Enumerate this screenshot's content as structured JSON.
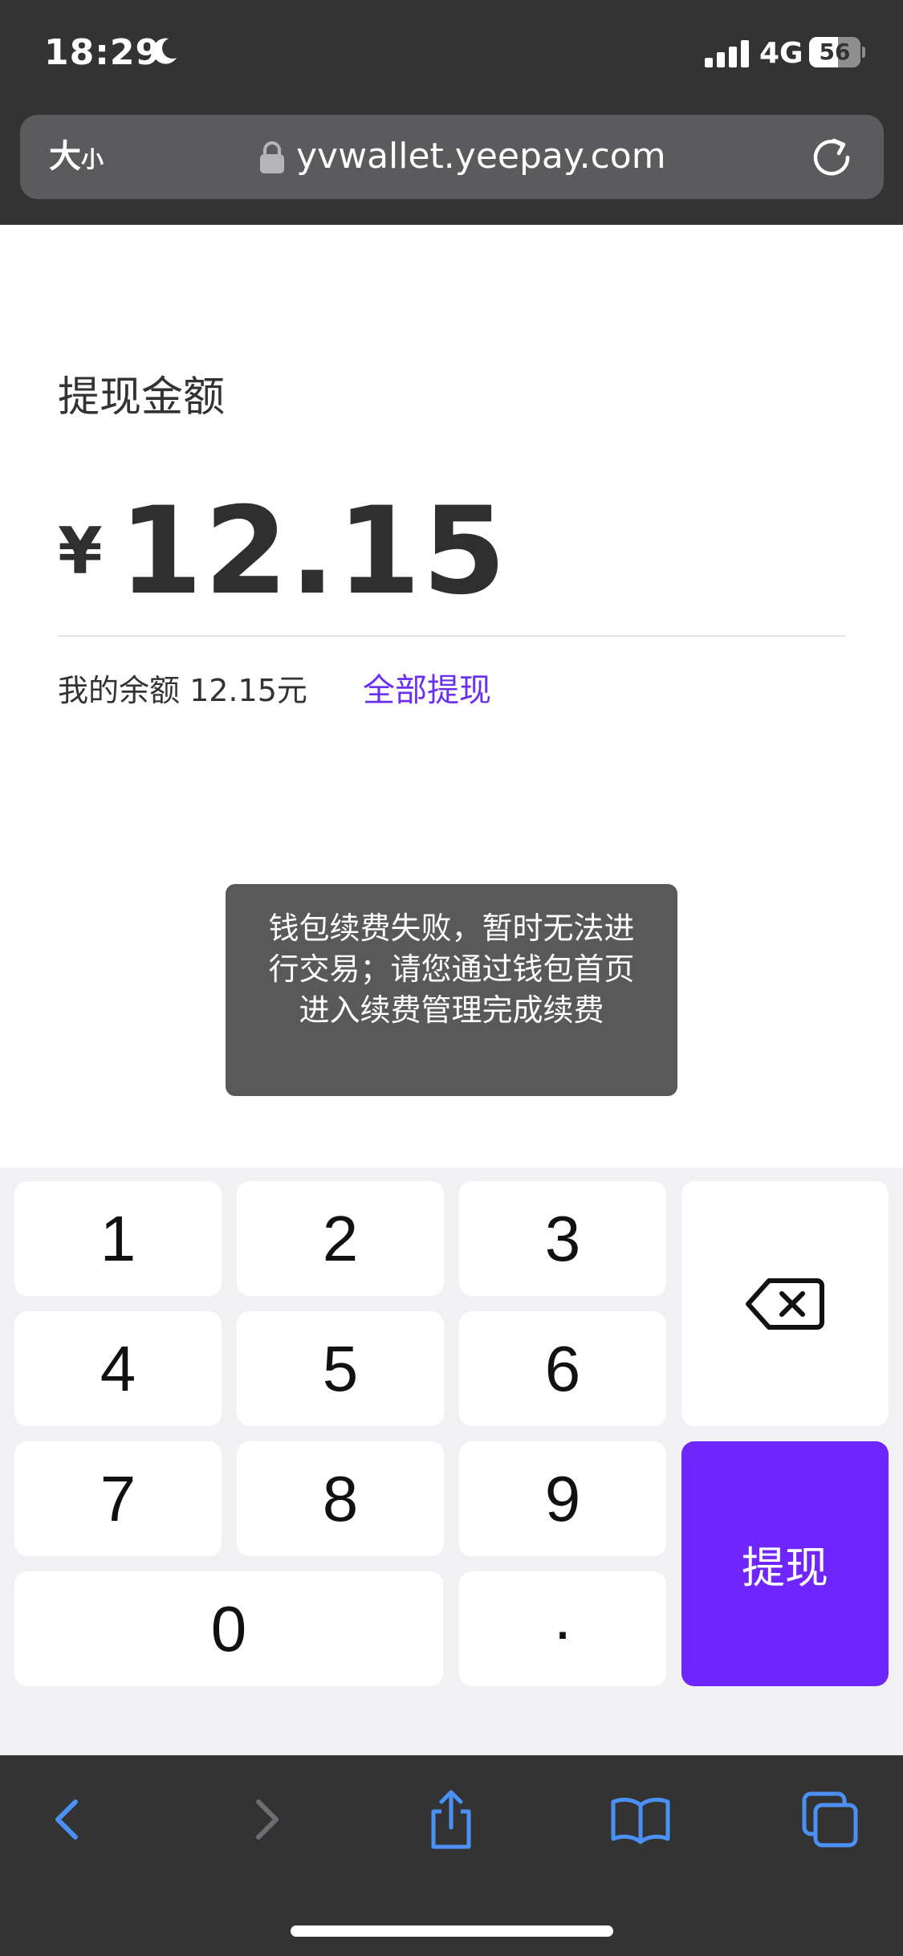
{
  "status_bar": {
    "time": "18:29",
    "network": "4G",
    "battery_level": "56",
    "battery_fraction": 0.56
  },
  "browser": {
    "text_size_large": "大",
    "text_size_small": "小",
    "url": "yvwallet.yeepay.com"
  },
  "withdraw": {
    "title": "提现金额",
    "currency_symbol": "¥",
    "amount": "12.15",
    "balance_text": "我的余额 12.15元",
    "withdraw_all_label": "全部提现"
  },
  "toast": {
    "message": "钱包续费失败，暂时无法进行交易；请您通过钱包首页进入续费管理完成续费"
  },
  "keypad": {
    "k1": "1",
    "k2": "2",
    "k3": "3",
    "k4": "4",
    "k5": "5",
    "k6": "6",
    "k7": "7",
    "k8": "8",
    "k9": "9",
    "k0": "0",
    "dot": ".",
    "submit_label": "提现"
  },
  "colors": {
    "chrome_background": "#333333",
    "accent": "#6e26fd",
    "link": "#6a2ff0",
    "toolbar_icon": "#4a90f5"
  },
  "icons": {
    "status": [
      "moon-icon",
      "signal-icon",
      "battery-icon"
    ],
    "address_bar": [
      "lock-icon",
      "reload-icon"
    ],
    "keypad": [
      "backspace-icon"
    ],
    "toolbar": [
      "back-icon",
      "forward-icon",
      "share-icon",
      "bookmarks-icon",
      "tabs-icon"
    ]
  }
}
